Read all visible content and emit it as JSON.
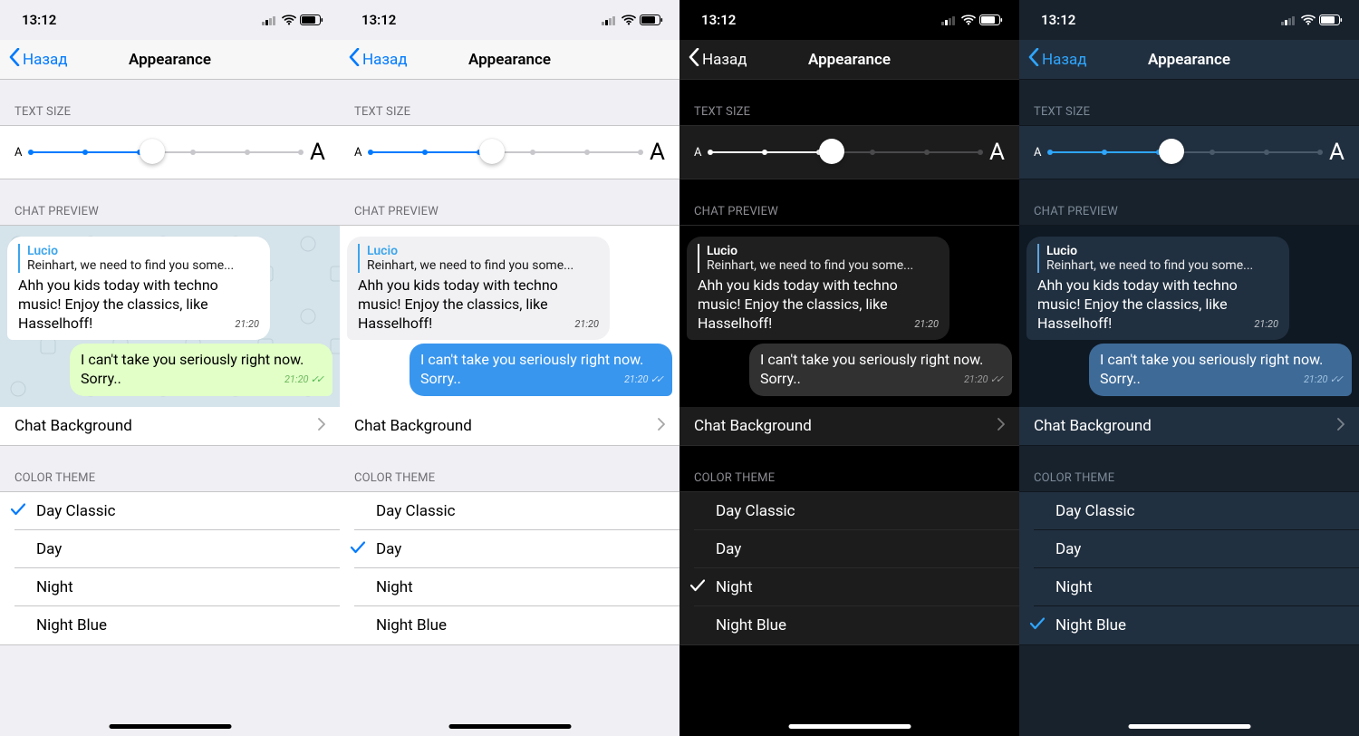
{
  "screens": [
    {
      "theme": "t-dayclassic",
      "selected": "Day Classic"
    },
    {
      "theme": "t-day",
      "selected": "Day"
    },
    {
      "theme": "t-night",
      "selected": "Night"
    },
    {
      "theme": "t-nightblue",
      "selected": "Night Blue"
    }
  ],
  "status": {
    "time": "13:12"
  },
  "nav": {
    "back": "Назад",
    "title": "Appearance"
  },
  "sections": {
    "text_size": "TEXT SIZE",
    "chat_preview": "CHAT PREVIEW",
    "chat_bg": "Chat Background",
    "color_theme": "COLOR THEME"
  },
  "themes": [
    "Day Classic",
    "Day",
    "Night",
    "Night Blue"
  ],
  "slider": {
    "ticks": 6,
    "value_pct": 45
  },
  "preview": {
    "reply_name": "Lucio",
    "reply_text": "Reinhart, we need to find you some...",
    "in_msg": "Ahh you kids today with techno music! Enjoy the classics, like Hasselhoff!",
    "in_time": "21:20",
    "out_msg": "I can't take you seriously right now. Sorry..",
    "out_time": "21:20"
  }
}
